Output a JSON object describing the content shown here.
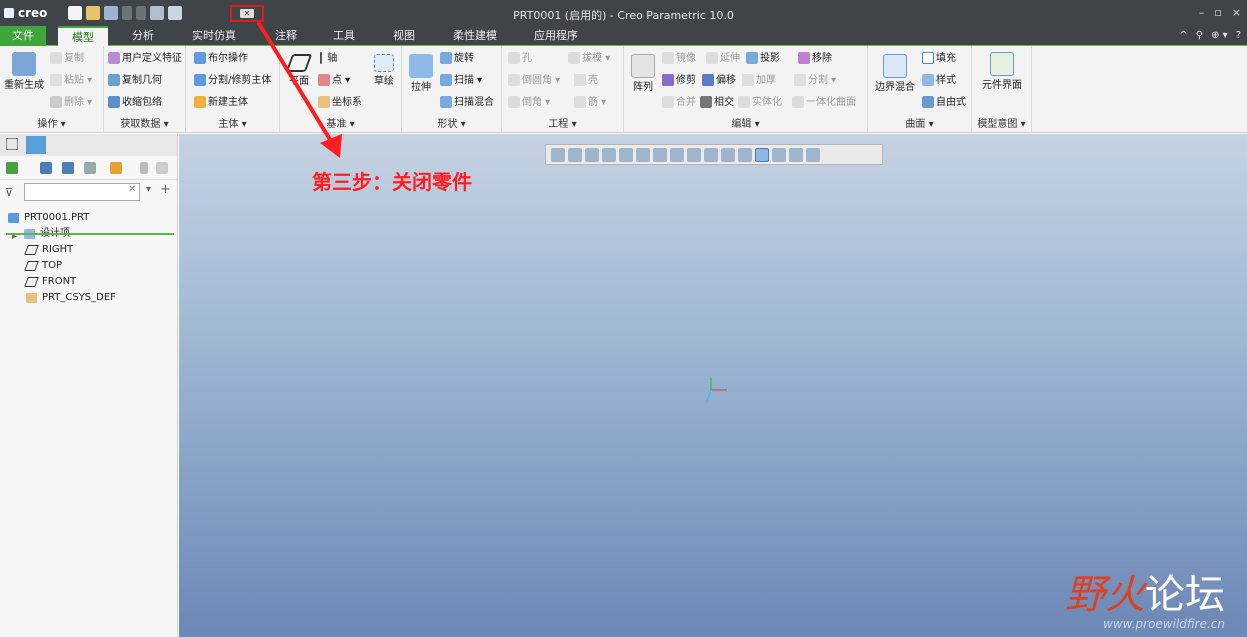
{
  "app": {
    "logo": "creo",
    "title": "PRT0001 (启用的) - Creo Parametric 10.0",
    "window_controls": [
      "–",
      "▫",
      "×"
    ]
  },
  "quick_access": {
    "close_window_icon": "close-window-icon"
  },
  "menu": {
    "tabs": [
      "文件",
      "模型",
      "分析",
      "实时仿真",
      "注释",
      "工具",
      "视图",
      "柔性建模",
      "应用程序"
    ],
    "active": "模型",
    "right_icons": [
      "^",
      "⚲",
      "⊕ ▾",
      "?"
    ]
  },
  "ribbon": {
    "groups": {
      "operations": {
        "label": "操作 ▾",
        "regenerate": "重新生成",
        "copy": "复制",
        "paste": "粘贴 ▾",
        "delete": "删除 ▾"
      },
      "get_data": {
        "label": "获取数据 ▾",
        "udf": "用户定义特征",
        "copy_geom": "复制几何",
        "shrinkwrap": "收缩包络"
      },
      "body": {
        "label": "主体 ▾",
        "boolean": "布尔操作",
        "split_trim": "分割/修剪主体",
        "new_body": "新建主体"
      },
      "datum": {
        "label": "基准 ▾",
        "plane": "平面",
        "axis": "轴",
        "point": "点 ▾",
        "csys": "坐标系",
        "sketch": "草绘"
      },
      "shapes": {
        "label": "形状 ▾",
        "extrude": "拉伸",
        "revolve": "旋转",
        "sweep": "扫描 ▾",
        "swept_blend": "扫描混合"
      },
      "engineering": {
        "label": "工程 ▾",
        "hole": "孔",
        "draft": "拔模 ▾",
        "round": "倒圆角 ▾",
        "shell": "壳",
        "chamfer": "倒角 ▾",
        "rib": "筋 ▾"
      },
      "editing": {
        "label": "编辑 ▾",
        "pattern": "阵列",
        "mirror": "镜像",
        "extend": "延伸",
        "project": "投影",
        "trim": "修剪",
        "offset": "偏移",
        "thicken": "加厚",
        "merge": "合并",
        "intersect": "相交",
        "solidify": "实体化",
        "remove": "移除",
        "split": "分割 ▾",
        "unify": "一体化曲面"
      },
      "surfaces": {
        "label": "曲面 ▾",
        "boundary_blend": "边界混合",
        "fill": "填充",
        "style": "样式",
        "freestyle": "自由式"
      },
      "model_intent": {
        "label": "模型意图 ▾",
        "component_interface": "元件界面"
      }
    }
  },
  "model_tree": {
    "filter_placeholder": "",
    "items": [
      "PRT0001.PRT",
      "设计项",
      "RIGHT",
      "TOP",
      "FRONT",
      "PRT_CSYS_DEF"
    ]
  },
  "annotation": {
    "step_text": "第三步：关闭零件",
    "color": "#ff1e1e"
  },
  "watermark": {
    "part1": "野火",
    "part2": "论坛",
    "url": "www.proewildfire.cn"
  },
  "colors": {
    "accent": "#3fa63a",
    "titlebar": "#3e4448"
  }
}
